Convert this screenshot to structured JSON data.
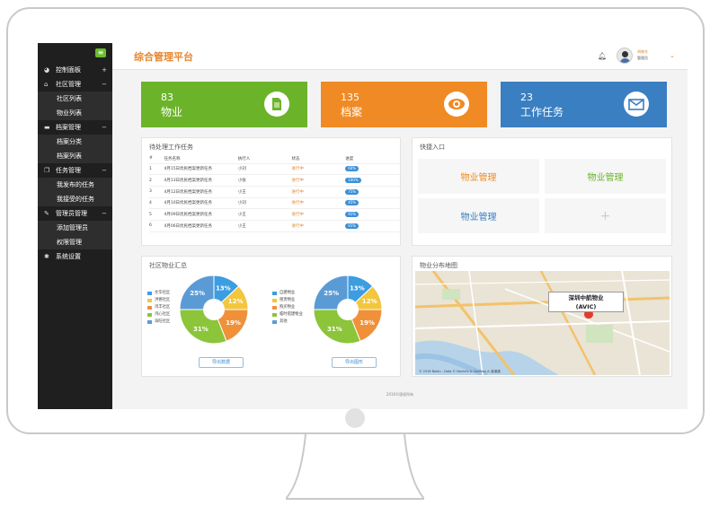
{
  "sidebar": {
    "groups": [
      {
        "label": "控制面板",
        "icon": "dashboard-icon",
        "sign": "+",
        "items": []
      },
      {
        "label": "社区管理",
        "icon": "home-icon",
        "sign": "−",
        "items": [
          "社区列表",
          "物业列表"
        ]
      },
      {
        "label": "档案管理",
        "icon": "folder-icon",
        "sign": "−",
        "items": [
          "档案分类",
          "档案列表"
        ]
      },
      {
        "label": "任务管理",
        "icon": "copy-icon",
        "sign": "−",
        "items": [
          "我发布的任务",
          "我接受的任务"
        ]
      },
      {
        "label": "管理员管理",
        "icon": "wrench-icon",
        "sign": "−",
        "items": [
          "添加管理员",
          "权限管理"
        ]
      },
      {
        "label": "系统设置",
        "icon": "gear-icon",
        "sign": "",
        "items": []
      }
    ]
  },
  "header": {
    "title": "综合管理平台",
    "user_name": "胡晓东",
    "user_role": "管理员"
  },
  "stats": [
    {
      "value": "83",
      "label": "物业",
      "color": "#6bb42a",
      "icon": "document-icon"
    },
    {
      "value": "135",
      "label": "档案",
      "color": "#f08a24",
      "icon": "eye-icon"
    },
    {
      "value": "23",
      "label": "工作任务",
      "color": "#3a7fc1",
      "icon": "envelope-icon"
    }
  ],
  "tasks": {
    "title": "待处理工作任务",
    "columns": [
      "#",
      "任务名称",
      "执行人",
      "状态",
      "进度"
    ],
    "rows": [
      {
        "n": "1",
        "name": "4月15日优民档案更新任务",
        "person": "小刘",
        "status": "进行中",
        "progress": "60%"
      },
      {
        "n": "2",
        "name": "4月13日优民档案更新任务",
        "person": "小张",
        "status": "进行中",
        "progress": "100%"
      },
      {
        "n": "3",
        "name": "4月12日优民档案更新任务",
        "person": "小王",
        "status": "进行中",
        "progress": "75%"
      },
      {
        "n": "4",
        "name": "4月10日优民档案更新任务",
        "person": "小刘",
        "status": "进行中",
        "progress": "45%"
      },
      {
        "n": "5",
        "name": "4月09日优民档案更新任务",
        "person": "小王",
        "status": "进行中",
        "progress": "91%"
      },
      {
        "n": "6",
        "name": "4月06日优民档案更新任务",
        "person": "小王",
        "status": "进行中",
        "progress": "91%"
      }
    ]
  },
  "quick": {
    "title": "快捷入口",
    "items": [
      {
        "label": "物业管理",
        "color": "#f08a24"
      },
      {
        "label": "物业管理",
        "color": "#6bb42a"
      },
      {
        "label": "物业管理",
        "color": "#3a7fc1"
      },
      {
        "label": "+",
        "color": "#cccccc"
      }
    ]
  },
  "summary": {
    "title": "社区物业汇总",
    "legend_left": [
      "文华社区",
      "洪德社区",
      "鸿丰社区",
      "鸿心社区",
      "海旺社区"
    ],
    "legend_right": [
      "自建物业",
      "租赁物业",
      "购买物业",
      "临时搭建物业",
      "其他"
    ],
    "button_left": "导出数据",
    "button_right": "导出图形"
  },
  "chart_data": [
    {
      "type": "pie",
      "values": [
        13,
        12,
        19,
        31,
        25
      ],
      "labels": [
        "13%",
        "12%",
        "19%",
        "31%",
        "25%"
      ],
      "colors": [
        "#3c9de0",
        "#f2c63d",
        "#f0913a",
        "#8cc43a",
        "#5b9bd5"
      ]
    },
    {
      "type": "pie",
      "values": [
        13,
        12,
        19,
        31,
        25
      ],
      "labels": [
        "13%",
        "12%",
        "19%",
        "31%",
        "25%"
      ],
      "colors": [
        "#3c9de0",
        "#f2c63d",
        "#f0913a",
        "#8cc43a",
        "#5b9bd5"
      ]
    }
  ],
  "map": {
    "title": "物业分布地图",
    "label_line1": "深圳中航物业",
    "label_line2": "(AVIC)",
    "copyright": "© 2016 Baidu - Data © NavInfo & CenNavi & 道道通"
  },
  "footer": "2016©版权所有"
}
